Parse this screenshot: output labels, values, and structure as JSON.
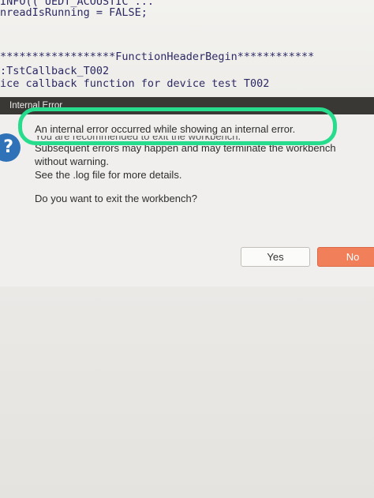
{
  "editor": {
    "lines": [
      "INFO(( UEDT_ACOUSTIC ...",
      "nreadIsRunning = FALSE;",
      "******************FunctionHeaderBegin************",
      ":TstCallback_T002",
      "ice callback function for device test T002"
    ]
  },
  "dialog": {
    "title": "Internal Error",
    "icon": "question-icon",
    "message_line1": "An internal error occurred while showing an internal error.",
    "message_obscured": "You are recommended to exit the workbench.",
    "message_line2": "Subsequent errors may happen and may terminate the workbench",
    "message_line3": "without warning.",
    "message_line4": "See the .log file for more details.",
    "question": "Do you want to exit the workbench?",
    "yes_label": "Yes",
    "no_label": "No"
  },
  "colors": {
    "titlebar": "#3a3835",
    "highlight": "#27dc8c",
    "no_button": "#f07f5a",
    "question_icon": "#2f72b8"
  }
}
